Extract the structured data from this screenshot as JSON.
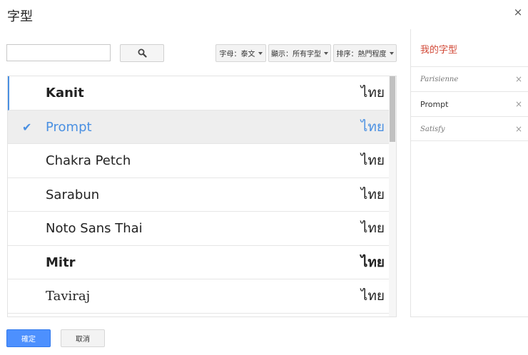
{
  "dialog": {
    "title": "字型",
    "close_icon": "×"
  },
  "search": {
    "value": "",
    "placeholder": "",
    "button_icon": "search-icon"
  },
  "filters": {
    "script_label": "字母：泰文",
    "show_label": "顯示：所有字型",
    "sort_label": "排序：熱門程度"
  },
  "font_list": {
    "rows": [
      {
        "name": "Kanit",
        "sample": "ไทย",
        "selected": false
      },
      {
        "name": "Prompt",
        "sample": "ไทย",
        "selected": true
      },
      {
        "name": "Chakra Petch",
        "sample": "ไทย",
        "selected": false
      },
      {
        "name": "Sarabun",
        "sample": "ไทย",
        "selected": false
      },
      {
        "name": "Noto Sans Thai",
        "sample": "ไทย",
        "selected": false
      },
      {
        "name": "Mitr",
        "sample": "ไทย",
        "selected": false
      },
      {
        "name": "Taviraj",
        "sample": "ไทย",
        "selected": false
      }
    ],
    "check_mark": "✔"
  },
  "my_fonts": {
    "title": "我的字型",
    "remove_icon": "×",
    "items": [
      {
        "name": "Parisienne"
      },
      {
        "name": "Prompt"
      },
      {
        "name": "Satisfy"
      }
    ]
  },
  "footer": {
    "ok_label": "確定",
    "cancel_label": "取消"
  },
  "colors": {
    "accent": "#4a90e2",
    "my_fonts_title": "#d14836",
    "ok_button": "#4d90fe"
  }
}
